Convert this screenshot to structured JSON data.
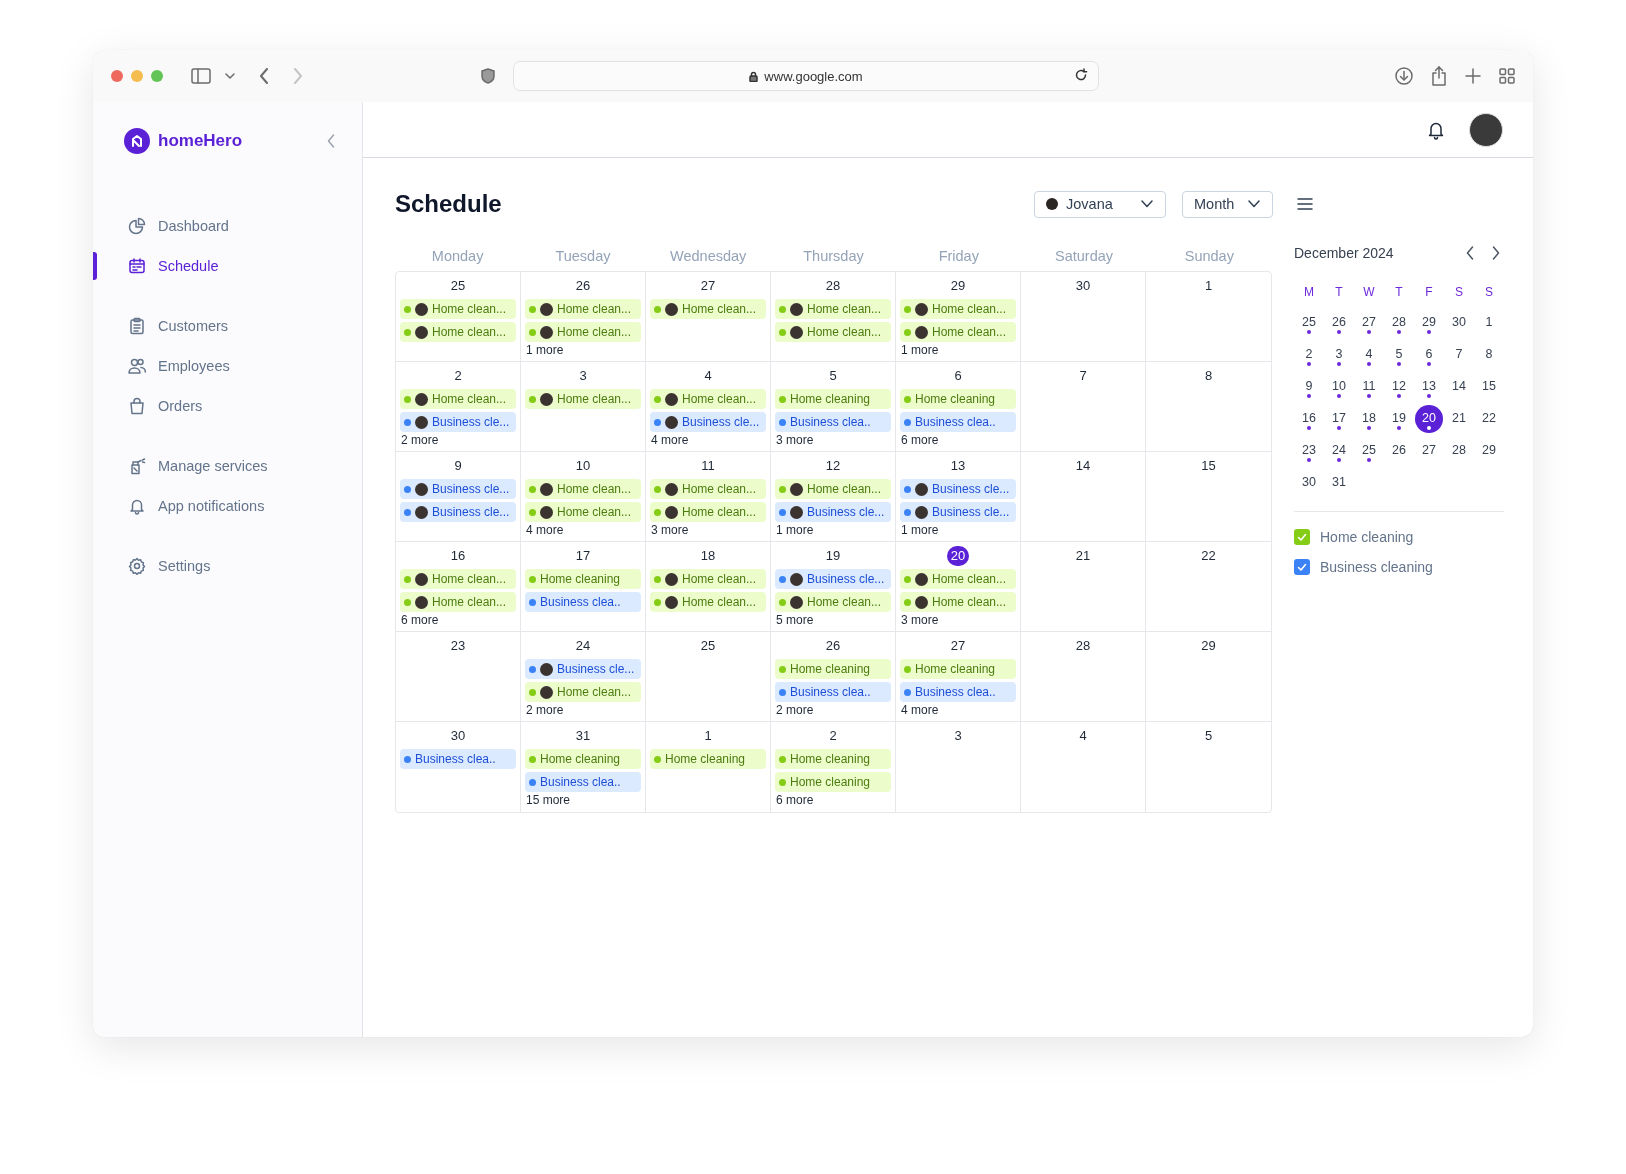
{
  "browser": {
    "url": "www.google.com"
  },
  "sidebar": {
    "brand": "homeHero",
    "groups": [
      {
        "items": [
          {
            "label": "Dashboard",
            "selected": false
          },
          {
            "label": "Schedule",
            "selected": true
          }
        ]
      },
      {
        "items": [
          {
            "label": "Customers",
            "selected": false
          },
          {
            "label": "Employees",
            "selected": false
          },
          {
            "label": "Orders",
            "selected": false
          }
        ]
      },
      {
        "items": [
          {
            "label": "Manage services",
            "selected": false
          },
          {
            "label": "App notifications",
            "selected": false
          }
        ]
      },
      {
        "items": [
          {
            "label": "Settings",
            "selected": false
          }
        ]
      }
    ]
  },
  "page": {
    "title": "Schedule",
    "employee_filter": "Jovana",
    "view_select": "Month"
  },
  "calendar": {
    "weekdays": [
      "Monday",
      "Tuesday",
      "Wednesday",
      "Thursday",
      "Friday",
      "Saturday",
      "Sunday"
    ],
    "weeks": [
      {
        "days": [
          {
            "day": "25",
            "today": false,
            "events": [
              {
                "kind": "home",
                "assigned": true,
                "text": "Home clean..."
              },
              {
                "kind": "home",
                "assigned": true,
                "text": "Home clean..."
              }
            ]
          },
          {
            "day": "26",
            "today": false,
            "events": [
              {
                "kind": "home",
                "assigned": true,
                "text": "Home clean..."
              },
              {
                "kind": "home",
                "assigned": true,
                "text": "Home clean..."
              }
            ],
            "more": "1 more"
          },
          {
            "day": "27",
            "today": false,
            "events": [
              {
                "kind": "home",
                "assigned": true,
                "text": "Home clean..."
              }
            ]
          },
          {
            "day": "28",
            "today": false,
            "events": [
              {
                "kind": "home",
                "assigned": true,
                "text": "Home clean..."
              },
              {
                "kind": "home",
                "assigned": true,
                "text": "Home clean..."
              }
            ]
          },
          {
            "day": "29",
            "today": false,
            "events": [
              {
                "kind": "home",
                "assigned": true,
                "text": "Home clean..."
              },
              {
                "kind": "home",
                "assigned": true,
                "text": "Home clean..."
              }
            ],
            "more": "1 more"
          },
          {
            "day": "30",
            "today": false
          },
          {
            "day": "1",
            "today": false
          }
        ]
      },
      {
        "days": [
          {
            "day": "2",
            "today": false,
            "events": [
              {
                "kind": "home",
                "assigned": true,
                "text": "Home clean..."
              },
              {
                "kind": "business",
                "assigned": true,
                "text": "Business cle..."
              }
            ],
            "more": "2 more"
          },
          {
            "day": "3",
            "today": false,
            "events": [
              {
                "kind": "home",
                "assigned": true,
                "text": "Home clean..."
              }
            ]
          },
          {
            "day": "4",
            "today": false,
            "events": [
              {
                "kind": "home",
                "assigned": true,
                "text": "Home clean..."
              },
              {
                "kind": "business",
                "assigned": true,
                "text": "Business cle..."
              }
            ],
            "more": "4 more"
          },
          {
            "day": "5",
            "today": false,
            "events": [
              {
                "kind": "home",
                "assigned": false,
                "text": "Home cleaning"
              },
              {
                "kind": "business",
                "assigned": false,
                "text": "Business clea.."
              }
            ],
            "more": "3 more"
          },
          {
            "day": "6",
            "today": false,
            "events": [
              {
                "kind": "home",
                "assigned": false,
                "text": "Home cleaning"
              },
              {
                "kind": "business",
                "assigned": false,
                "text": "Business clea.."
              }
            ],
            "more": "6 more"
          },
          {
            "day": "7",
            "today": false
          },
          {
            "day": "8",
            "today": false
          }
        ]
      },
      {
        "days": [
          {
            "day": "9",
            "today": false,
            "events": [
              {
                "kind": "business",
                "assigned": true,
                "text": "Business cle..."
              },
              {
                "kind": "business",
                "assigned": true,
                "text": "Business cle..."
              }
            ]
          },
          {
            "day": "10",
            "today": false,
            "events": [
              {
                "kind": "home",
                "assigned": true,
                "text": "Home clean..."
              },
              {
                "kind": "home",
                "assigned": true,
                "text": "Home clean..."
              }
            ],
            "more": "4 more"
          },
          {
            "day": "11",
            "today": false,
            "events": [
              {
                "kind": "home",
                "assigned": true,
                "text": "Home clean..."
              },
              {
                "kind": "home",
                "assigned": true,
                "text": "Home clean..."
              }
            ],
            "more": "3 more"
          },
          {
            "day": "12",
            "today": false,
            "events": [
              {
                "kind": "home",
                "assigned": true,
                "text": "Home clean..."
              },
              {
                "kind": "business",
                "assigned": true,
                "text": "Business cle..."
              }
            ],
            "more": "1 more"
          },
          {
            "day": "13",
            "today": false,
            "events": [
              {
                "kind": "business",
                "assigned": true,
                "text": "Business cle..."
              },
              {
                "kind": "business",
                "assigned": true,
                "text": "Business cle..."
              }
            ],
            "more": "1 more"
          },
          {
            "day": "14",
            "today": false
          },
          {
            "day": "15",
            "today": false
          }
        ]
      },
      {
        "days": [
          {
            "day": "16",
            "today": false,
            "events": [
              {
                "kind": "home",
                "assigned": true,
                "text": "Home clean..."
              },
              {
                "kind": "home",
                "assigned": true,
                "text": "Home clean..."
              }
            ],
            "more": "6 more"
          },
          {
            "day": "17",
            "today": false,
            "events": [
              {
                "kind": "home",
                "assigned": false,
                "text": "Home cleaning"
              },
              {
                "kind": "business",
                "assigned": false,
                "text": "Business clea.."
              }
            ]
          },
          {
            "day": "18",
            "today": false,
            "events": [
              {
                "kind": "home",
                "assigned": true,
                "text": "Home clean..."
              },
              {
                "kind": "home",
                "assigned": true,
                "text": "Home clean..."
              }
            ]
          },
          {
            "day": "19",
            "today": false,
            "events": [
              {
                "kind": "business",
                "assigned": true,
                "text": "Business cle..."
              },
              {
                "kind": "home",
                "assigned": true,
                "text": "Home clean..."
              }
            ],
            "more": "5 more"
          },
          {
            "day": "20",
            "today": true,
            "events": [
              {
                "kind": "home",
                "assigned": true,
                "text": "Home clean..."
              },
              {
                "kind": "home",
                "assigned": true,
                "text": "Home clean..."
              }
            ],
            "more": "3 more"
          },
          {
            "day": "21",
            "today": false
          },
          {
            "day": "22",
            "today": false
          }
        ]
      },
      {
        "days": [
          {
            "day": "23",
            "today": false
          },
          {
            "day": "24",
            "today": false,
            "events": [
              {
                "kind": "business",
                "assigned": true,
                "text": "Business cle..."
              },
              {
                "kind": "home",
                "assigned": true,
                "text": "Home clean..."
              }
            ],
            "more": "2 more"
          },
          {
            "day": "25",
            "today": false
          },
          {
            "day": "26",
            "today": false,
            "events": [
              {
                "kind": "home",
                "assigned": false,
                "text": "Home cleaning"
              },
              {
                "kind": "business",
                "assigned": false,
                "text": "Business clea.."
              }
            ],
            "more": "2 more"
          },
          {
            "day": "27",
            "today": false,
            "events": [
              {
                "kind": "home",
                "assigned": false,
                "text": "Home cleaning"
              },
              {
                "kind": "business",
                "assigned": false,
                "text": "Business clea.."
              }
            ],
            "more": "4 more"
          },
          {
            "day": "28",
            "today": false
          },
          {
            "day": "29",
            "today": false
          }
        ]
      },
      {
        "days": [
          {
            "day": "30",
            "today": false,
            "events": [
              {
                "kind": "business",
                "assigned": false,
                "text": "Business clea.."
              }
            ]
          },
          {
            "day": "31",
            "today": false,
            "events": [
              {
                "kind": "home",
                "assigned": false,
                "text": "Home cleaning"
              },
              {
                "kind": "business",
                "assigned": false,
                "text": "Business clea.."
              }
            ],
            "more": "15 more"
          },
          {
            "day": "1",
            "today": false,
            "events": [
              {
                "kind": "home",
                "assigned": false,
                "text": "Home cleaning"
              }
            ]
          },
          {
            "day": "2",
            "today": false,
            "events": [
              {
                "kind": "home",
                "assigned": false,
                "text": "Home cleaning"
              },
              {
                "kind": "home",
                "assigned": false,
                "text": "Home cleaning"
              }
            ],
            "more": "6 more"
          },
          {
            "day": "3",
            "today": false
          },
          {
            "day": "4",
            "today": false
          },
          {
            "day": "5",
            "today": false
          }
        ]
      }
    ]
  },
  "mini_calendar": {
    "month": "December 2024",
    "weekdays": [
      "M",
      "T",
      "W",
      "T",
      "F",
      "S",
      "S"
    ],
    "days": [
      {
        "day": "25",
        "dot": true,
        "selected": false
      },
      {
        "day": "26",
        "dot": true,
        "selected": false
      },
      {
        "day": "27",
        "dot": true,
        "selected": false
      },
      {
        "day": "28",
        "dot": true,
        "selected": false
      },
      {
        "day": "29",
        "dot": true,
        "selected": false
      },
      {
        "day": "30",
        "dot": false,
        "selected": false
      },
      {
        "day": "1",
        "dot": false,
        "selected": false
      },
      {
        "day": "2",
        "dot": true,
        "selected": false
      },
      {
        "day": "3",
        "dot": true,
        "selected": false
      },
      {
        "day": "4",
        "dot": true,
        "selected": false
      },
      {
        "day": "5",
        "dot": true,
        "selected": false
      },
      {
        "day": "6",
        "dot": true,
        "selected": false
      },
      {
        "day": "7",
        "dot": false,
        "selected": false
      },
      {
        "day": "8",
        "dot": false,
        "selected": false
      },
      {
        "day": "9",
        "dot": true,
        "selected": false
      },
      {
        "day": "10",
        "dot": true,
        "selected": false
      },
      {
        "day": "11",
        "dot": true,
        "selected": false
      },
      {
        "day": "12",
        "dot": true,
        "selected": false
      },
      {
        "day": "13",
        "dot": true,
        "selected": false
      },
      {
        "day": "14",
        "dot": false,
        "selected": false
      },
      {
        "day": "15",
        "dot": false,
        "selected": false
      },
      {
        "day": "16",
        "dot": true,
        "selected": false
      },
      {
        "day": "17",
        "dot": true,
        "selected": false
      },
      {
        "day": "18",
        "dot": true,
        "selected": false
      },
      {
        "day": "19",
        "dot": true,
        "selected": false
      },
      {
        "day": "20",
        "dot": true,
        "selected": true
      },
      {
        "day": "21",
        "dot": false,
        "selected": false
      },
      {
        "day": "22",
        "dot": false,
        "selected": false
      },
      {
        "day": "23",
        "dot": true,
        "selected": false
      },
      {
        "day": "24",
        "dot": true,
        "selected": false
      },
      {
        "day": "25",
        "dot": true,
        "selected": false
      },
      {
        "day": "26",
        "dot": false,
        "selected": false
      },
      {
        "day": "27",
        "dot": false,
        "selected": false
      },
      {
        "day": "28",
        "dot": false,
        "selected": false
      },
      {
        "day": "29",
        "dot": false,
        "selected": false
      },
      {
        "day": "30",
        "dot": false,
        "selected": false
      },
      {
        "day": "31",
        "dot": false,
        "selected": false
      }
    ]
  },
  "legend": [
    {
      "label": "Home cleaning",
      "checked": true,
      "color": "#84cc16"
    },
    {
      "label": "Business cleaning",
      "checked": true,
      "color": "#3b82f6"
    }
  ]
}
